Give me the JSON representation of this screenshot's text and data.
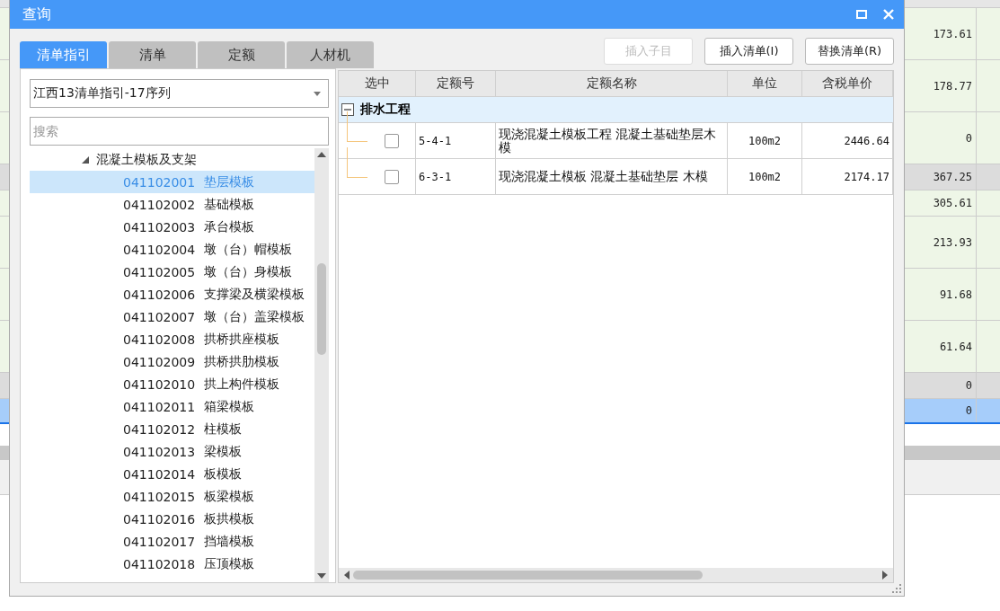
{
  "background": {
    "rows": [
      {
        "value": "173.61",
        "kind": "normal"
      },
      {
        "value": "178.77",
        "kind": "normal"
      },
      {
        "value": "0",
        "kind": "normal"
      },
      {
        "value": "367.25",
        "kind": "total"
      },
      {
        "value": "305.61",
        "kind": "normal"
      },
      {
        "value": "213.93",
        "kind": "normal"
      },
      {
        "value": "91.68",
        "kind": "normal"
      },
      {
        "value": "61.64",
        "kind": "normal"
      },
      {
        "value": "0",
        "kind": "total"
      },
      {
        "value": "0",
        "kind": "selected"
      }
    ]
  },
  "dialog": {
    "title": "查询",
    "tabs": [
      {
        "label": "清单指引",
        "selected": true
      },
      {
        "label": "清单",
        "selected": false
      },
      {
        "label": "定额",
        "selected": false
      },
      {
        "label": "人材机",
        "selected": false
      }
    ],
    "buttons": [
      {
        "label": "插入子目",
        "disabled": true
      },
      {
        "label": "插入清单(I)",
        "disabled": false
      },
      {
        "label": "替换清单(R)",
        "disabled": false
      }
    ],
    "library_select": {
      "value": "江西13清单指引-17序列"
    },
    "search": {
      "placeholder": "搜索"
    },
    "tree": [
      {
        "label": "混凝土模板及支架",
        "expanded": true,
        "children": [
          {
            "code": "041102001",
            "name": "垫层模板",
            "selected": true
          },
          {
            "code": "041102002",
            "name": "基础模板",
            "selected": false
          },
          {
            "code": "041102003",
            "name": "承台模板",
            "selected": false
          },
          {
            "code": "041102004",
            "name": "墩（台）帽模板",
            "selected": false
          },
          {
            "code": "041102005",
            "name": "墩（台）身模板",
            "selected": false
          },
          {
            "code": "041102006",
            "name": "支撑梁及横梁模板",
            "selected": false
          },
          {
            "code": "041102007",
            "name": "墩（台）盖梁模板",
            "selected": false
          },
          {
            "code": "041102008",
            "name": "拱桥拱座模板",
            "selected": false
          },
          {
            "code": "041102009",
            "name": "拱桥拱肋模板",
            "selected": false
          },
          {
            "code": "041102010",
            "name": "拱上构件模板",
            "selected": false
          },
          {
            "code": "041102011",
            "name": "箱梁模板",
            "selected": false
          },
          {
            "code": "041102012",
            "name": "柱模板",
            "selected": false
          },
          {
            "code": "041102013",
            "name": "梁模板",
            "selected": false
          },
          {
            "code": "041102014",
            "name": "板模板",
            "selected": false
          },
          {
            "code": "041102015",
            "name": "板梁模板",
            "selected": false
          },
          {
            "code": "041102016",
            "name": "板拱模板",
            "selected": false
          },
          {
            "code": "041102017",
            "name": "挡墙模板",
            "selected": false
          },
          {
            "code": "041102018",
            "name": "压顶模板",
            "selected": false
          }
        ]
      }
    ],
    "table": {
      "columns": [
        "选中",
        "定额号",
        "定额名称",
        "单位",
        "含税单价"
      ],
      "groups": [
        {
          "name": "排水工程",
          "expanded": true,
          "rows": [
            {
              "checked": false,
              "code": "5-4-1",
              "name": "现浇混凝土模板工程 混凝土基础垫层木模",
              "unit": "100m2",
              "price": "2446.64"
            },
            {
              "checked": false,
              "code": "6-3-1",
              "name": "现浇混凝土模板 混凝土基础垫层 木模",
              "unit": "100m2",
              "price": "2174.17"
            }
          ]
        }
      ]
    }
  }
}
